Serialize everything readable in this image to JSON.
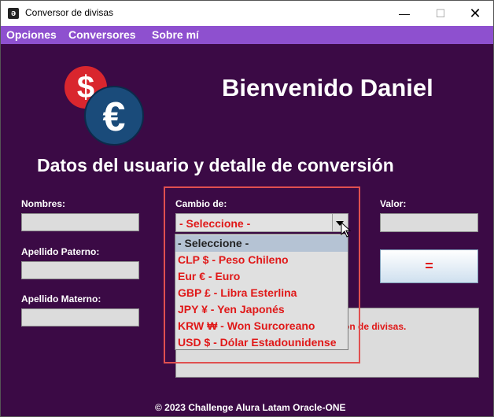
{
  "window": {
    "title": "Conversor de divisas",
    "icon": "app-icon",
    "minimize": "—",
    "maximize": "☐",
    "close": "✕"
  },
  "menu": {
    "items": [
      "Opciones",
      "Conversores",
      "Sobre mí"
    ]
  },
  "logo": {
    "dollar": "$",
    "euro": "€"
  },
  "header": {
    "welcome": "Bienvenido Daniel"
  },
  "section": {
    "title": "Datos del usuario y detalle de conversión"
  },
  "form": {
    "nombres_label": "Nombres:",
    "apellido_paterno_label": "Apellido Paterno:",
    "apellido_materno_label": "Apellido Materno:",
    "nombres_value": "",
    "apellido_paterno_value": "",
    "apellido_materno_value": ""
  },
  "conversion": {
    "cambio_label": "Cambio de:",
    "selected": "- Seleccione -",
    "options": [
      "- Seleccione -",
      "CLP $ - Peso Chileno",
      "Eur € - Euro",
      "GBP £ - Libra Esterlina",
      "JPY ¥ - Yen Japonés",
      "KRW ₩ - Won Surcoreano",
      "USD $ - Dólar Estadounidense"
    ],
    "valor_label": "Valor:",
    "valor_value": "",
    "equals_label": "=",
    "result_text_visible": "sión de divisas."
  },
  "footer": {
    "text": "© 2023 Challenge Alura Latam Oracle-ONE"
  },
  "colors": {
    "background": "#3b0a45",
    "menubar": "#8e50cf",
    "accent_red": "#e01818",
    "highlight": "#e05050"
  }
}
